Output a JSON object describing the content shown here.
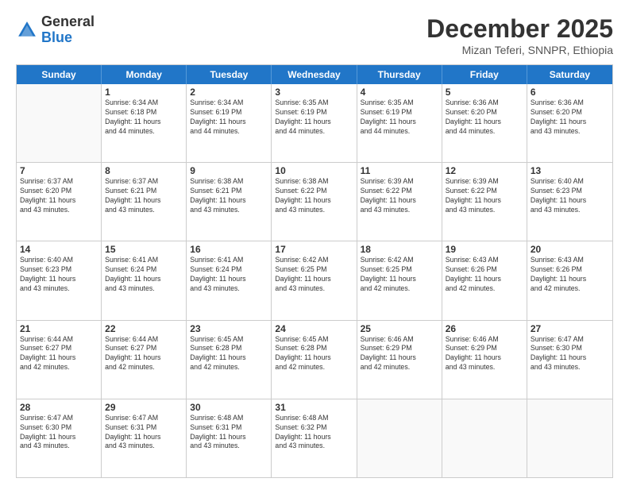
{
  "header": {
    "logo_general": "General",
    "logo_blue": "Blue",
    "main_title": "December 2025",
    "subtitle": "Mizan Teferi, SNNPR, Ethiopia"
  },
  "days_of_week": [
    "Sunday",
    "Monday",
    "Tuesday",
    "Wednesday",
    "Thursday",
    "Friday",
    "Saturday"
  ],
  "weeks": [
    [
      {
        "day": "",
        "info": ""
      },
      {
        "day": "1",
        "info": "Sunrise: 6:34 AM\nSunset: 6:18 PM\nDaylight: 11 hours\nand 44 minutes."
      },
      {
        "day": "2",
        "info": "Sunrise: 6:34 AM\nSunset: 6:19 PM\nDaylight: 11 hours\nand 44 minutes."
      },
      {
        "day": "3",
        "info": "Sunrise: 6:35 AM\nSunset: 6:19 PM\nDaylight: 11 hours\nand 44 minutes."
      },
      {
        "day": "4",
        "info": "Sunrise: 6:35 AM\nSunset: 6:19 PM\nDaylight: 11 hours\nand 44 minutes."
      },
      {
        "day": "5",
        "info": "Sunrise: 6:36 AM\nSunset: 6:20 PM\nDaylight: 11 hours\nand 44 minutes."
      },
      {
        "day": "6",
        "info": "Sunrise: 6:36 AM\nSunset: 6:20 PM\nDaylight: 11 hours\nand 43 minutes."
      }
    ],
    [
      {
        "day": "7",
        "info": "Sunrise: 6:37 AM\nSunset: 6:20 PM\nDaylight: 11 hours\nand 43 minutes."
      },
      {
        "day": "8",
        "info": "Sunrise: 6:37 AM\nSunset: 6:21 PM\nDaylight: 11 hours\nand 43 minutes."
      },
      {
        "day": "9",
        "info": "Sunrise: 6:38 AM\nSunset: 6:21 PM\nDaylight: 11 hours\nand 43 minutes."
      },
      {
        "day": "10",
        "info": "Sunrise: 6:38 AM\nSunset: 6:22 PM\nDaylight: 11 hours\nand 43 minutes."
      },
      {
        "day": "11",
        "info": "Sunrise: 6:39 AM\nSunset: 6:22 PM\nDaylight: 11 hours\nand 43 minutes."
      },
      {
        "day": "12",
        "info": "Sunrise: 6:39 AM\nSunset: 6:22 PM\nDaylight: 11 hours\nand 43 minutes."
      },
      {
        "day": "13",
        "info": "Sunrise: 6:40 AM\nSunset: 6:23 PM\nDaylight: 11 hours\nand 43 minutes."
      }
    ],
    [
      {
        "day": "14",
        "info": "Sunrise: 6:40 AM\nSunset: 6:23 PM\nDaylight: 11 hours\nand 43 minutes."
      },
      {
        "day": "15",
        "info": "Sunrise: 6:41 AM\nSunset: 6:24 PM\nDaylight: 11 hours\nand 43 minutes."
      },
      {
        "day": "16",
        "info": "Sunrise: 6:41 AM\nSunset: 6:24 PM\nDaylight: 11 hours\nand 43 minutes."
      },
      {
        "day": "17",
        "info": "Sunrise: 6:42 AM\nSunset: 6:25 PM\nDaylight: 11 hours\nand 43 minutes."
      },
      {
        "day": "18",
        "info": "Sunrise: 6:42 AM\nSunset: 6:25 PM\nDaylight: 11 hours\nand 42 minutes."
      },
      {
        "day": "19",
        "info": "Sunrise: 6:43 AM\nSunset: 6:26 PM\nDaylight: 11 hours\nand 42 minutes."
      },
      {
        "day": "20",
        "info": "Sunrise: 6:43 AM\nSunset: 6:26 PM\nDaylight: 11 hours\nand 42 minutes."
      }
    ],
    [
      {
        "day": "21",
        "info": "Sunrise: 6:44 AM\nSunset: 6:27 PM\nDaylight: 11 hours\nand 42 minutes."
      },
      {
        "day": "22",
        "info": "Sunrise: 6:44 AM\nSunset: 6:27 PM\nDaylight: 11 hours\nand 42 minutes."
      },
      {
        "day": "23",
        "info": "Sunrise: 6:45 AM\nSunset: 6:28 PM\nDaylight: 11 hours\nand 42 minutes."
      },
      {
        "day": "24",
        "info": "Sunrise: 6:45 AM\nSunset: 6:28 PM\nDaylight: 11 hours\nand 42 minutes."
      },
      {
        "day": "25",
        "info": "Sunrise: 6:46 AM\nSunset: 6:29 PM\nDaylight: 11 hours\nand 42 minutes."
      },
      {
        "day": "26",
        "info": "Sunrise: 6:46 AM\nSunset: 6:29 PM\nDaylight: 11 hours\nand 43 minutes."
      },
      {
        "day": "27",
        "info": "Sunrise: 6:47 AM\nSunset: 6:30 PM\nDaylight: 11 hours\nand 43 minutes."
      }
    ],
    [
      {
        "day": "28",
        "info": "Sunrise: 6:47 AM\nSunset: 6:30 PM\nDaylight: 11 hours\nand 43 minutes."
      },
      {
        "day": "29",
        "info": "Sunrise: 6:47 AM\nSunset: 6:31 PM\nDaylight: 11 hours\nand 43 minutes."
      },
      {
        "day": "30",
        "info": "Sunrise: 6:48 AM\nSunset: 6:31 PM\nDaylight: 11 hours\nand 43 minutes."
      },
      {
        "day": "31",
        "info": "Sunrise: 6:48 AM\nSunset: 6:32 PM\nDaylight: 11 hours\nand 43 minutes."
      },
      {
        "day": "",
        "info": ""
      },
      {
        "day": "",
        "info": ""
      },
      {
        "day": "",
        "info": ""
      }
    ]
  ]
}
